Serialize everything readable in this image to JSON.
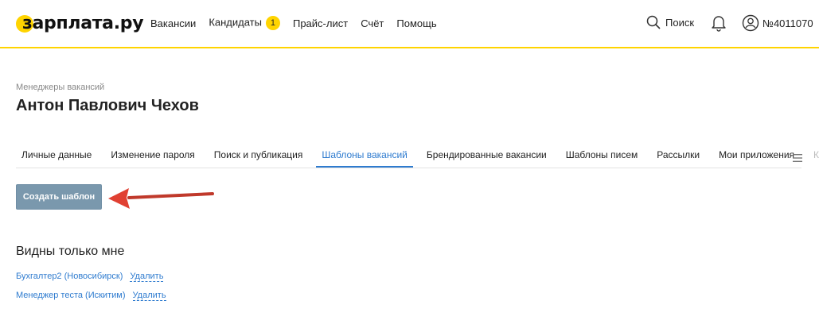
{
  "header": {
    "logo_text": "зарплата.ру",
    "nav": [
      {
        "label": "Вакансии"
      },
      {
        "label": "Кандидаты",
        "badge": "1"
      },
      {
        "label": "Прайс-лист"
      },
      {
        "label": "Счёт"
      },
      {
        "label": "Помощь"
      }
    ],
    "search_label": "Поиск",
    "account_label": "№4011070",
    "accent_color": "#ffd400"
  },
  "breadcrumb": "Менеджеры вакансий",
  "page_title": "Антон Павлович Чехов",
  "tabs": [
    {
      "label": "Личные данные"
    },
    {
      "label": "Изменение пароля"
    },
    {
      "label": "Поиск и публикация"
    },
    {
      "label": "Шаблоны вакансий",
      "active": true
    },
    {
      "label": "Брендированные вакансии"
    },
    {
      "label": "Шаблоны писем"
    },
    {
      "label": "Рассылки"
    },
    {
      "label": "Мои приложения"
    },
    {
      "label": "Ква"
    }
  ],
  "create_button": "Создать шаблон",
  "section_title": "Видны только мне",
  "templates": [
    {
      "name": "Бухгалтер2 (Новосибирск)",
      "delete": "Удалить"
    },
    {
      "name": "Менеджер теста (Искитим)",
      "delete": "Удалить"
    }
  ],
  "icons": {
    "search": "search-icon",
    "bell": "bell-icon",
    "user": "user-icon",
    "menu": "hamburger-menu-icon",
    "arrow": "red-arrow-icon"
  }
}
